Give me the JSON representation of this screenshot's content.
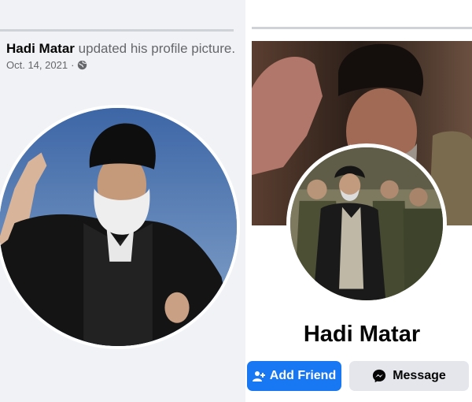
{
  "post": {
    "author": "Hadi Matar",
    "action": "updated his profile picture.",
    "date": "Oct. 14, 2021",
    "separator": "·",
    "privacy_icon": "globe-icon"
  },
  "profile": {
    "name": "Hadi Matar",
    "add_friend_label": "Add Friend",
    "message_label": "Message",
    "add_friend_icon": "add-person-icon",
    "message_icon": "messenger-icon"
  },
  "colors": {
    "primary": "#1877f2",
    "secondary_button": "#e4e6eb",
    "text": "#050505",
    "muted": "#65676b"
  }
}
